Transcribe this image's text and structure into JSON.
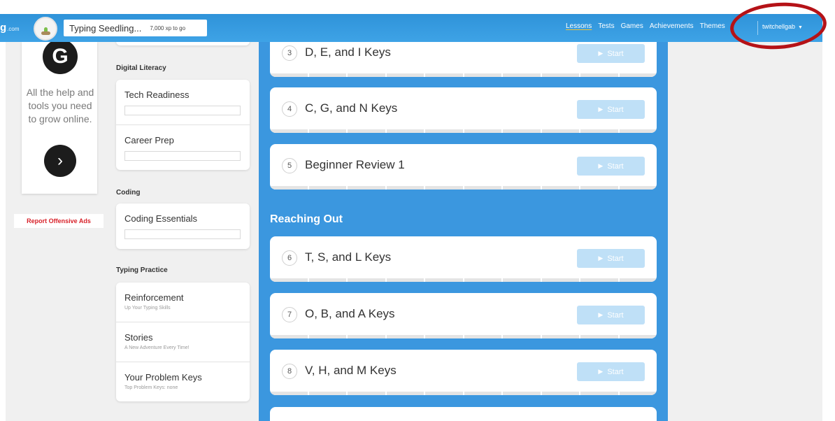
{
  "header": {
    "logo_partial": "g",
    "logo_suffix": ".com",
    "level_name": "Typing Seedling...",
    "xp_to_go": "7,000 xp to go",
    "nav": [
      "Lessons",
      "Tests",
      "Games",
      "Achievements",
      "Themes"
    ],
    "username": "twitchellgab",
    "caret": "▼"
  },
  "ad": {
    "logo_glyph": "G",
    "text": "All the help and tools you need to grow online.",
    "arrow_glyph": "›",
    "report_label": "Report Offensive Ads"
  },
  "sidebar": {
    "digital_literacy_heading": "Digital Literacy",
    "digital_literacy_items": [
      "Tech Readiness",
      "Career Prep"
    ],
    "coding_heading": "Coding",
    "coding_items": [
      "Coding Essentials"
    ],
    "typing_practice_heading": "Typing Practice",
    "typing_practice_items": [
      {
        "title": "Reinforcement",
        "subtitle": "Up Your Typing Skills"
      },
      {
        "title": "Stories",
        "subtitle": "A New Adventure Every Time!"
      },
      {
        "title": "Your Problem Keys",
        "subtitle": "Top Problem Keys: none"
      }
    ]
  },
  "lessons": {
    "start_label": "Start",
    "section_title": "Reaching Out",
    "items": [
      {
        "num": "3",
        "title": "D, E, and I Keys"
      },
      {
        "num": "4",
        "title": "C, G, and N Keys"
      },
      {
        "num": "5",
        "title": "Beginner Review 1"
      },
      {
        "num": "6",
        "title": "T, S, and L Keys"
      },
      {
        "num": "7",
        "title": "O, B, and A Keys"
      },
      {
        "num": "8",
        "title": "V, H, and M Keys"
      }
    ]
  },
  "colors": {
    "header_blue": "#3a9ee3",
    "main_blue": "#3b97df",
    "start_button": "#bfe0f7",
    "annotation_red": "#b51217",
    "report_red": "#d8222a"
  }
}
